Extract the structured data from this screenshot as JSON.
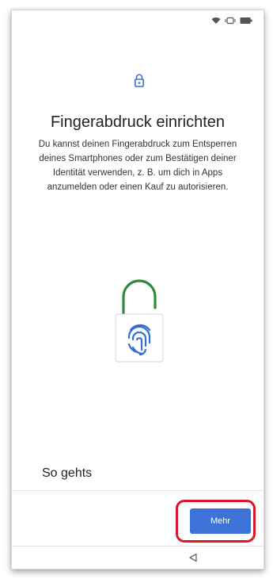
{
  "status_bar": {
    "icons": [
      "wifi-icon",
      "vibrate-icon",
      "battery-icon"
    ]
  },
  "header": {
    "icon": "lock-icon",
    "title": "Fingerabdruck einrichten",
    "description": "Du kannst deinen Fingerabdruck zum Entsperren deines Smartphones oder zum Bestätigen deiner Identität verwenden, z. B. um dich in Apps anzumelden oder einen Kauf zu autorisieren."
  },
  "illustration": {
    "icon": "fingerprint-padlock-icon",
    "colors": {
      "shackle": "#2d8a3e",
      "fingerprint": "#2f6fd6"
    }
  },
  "section": {
    "so_gehts": "So gehts"
  },
  "footer": {
    "more_label": "Mehr",
    "accent": "#3d73d9",
    "highlight": "#d7182a"
  },
  "nav_bar": {
    "back_icon": "back-triangle-icon"
  }
}
